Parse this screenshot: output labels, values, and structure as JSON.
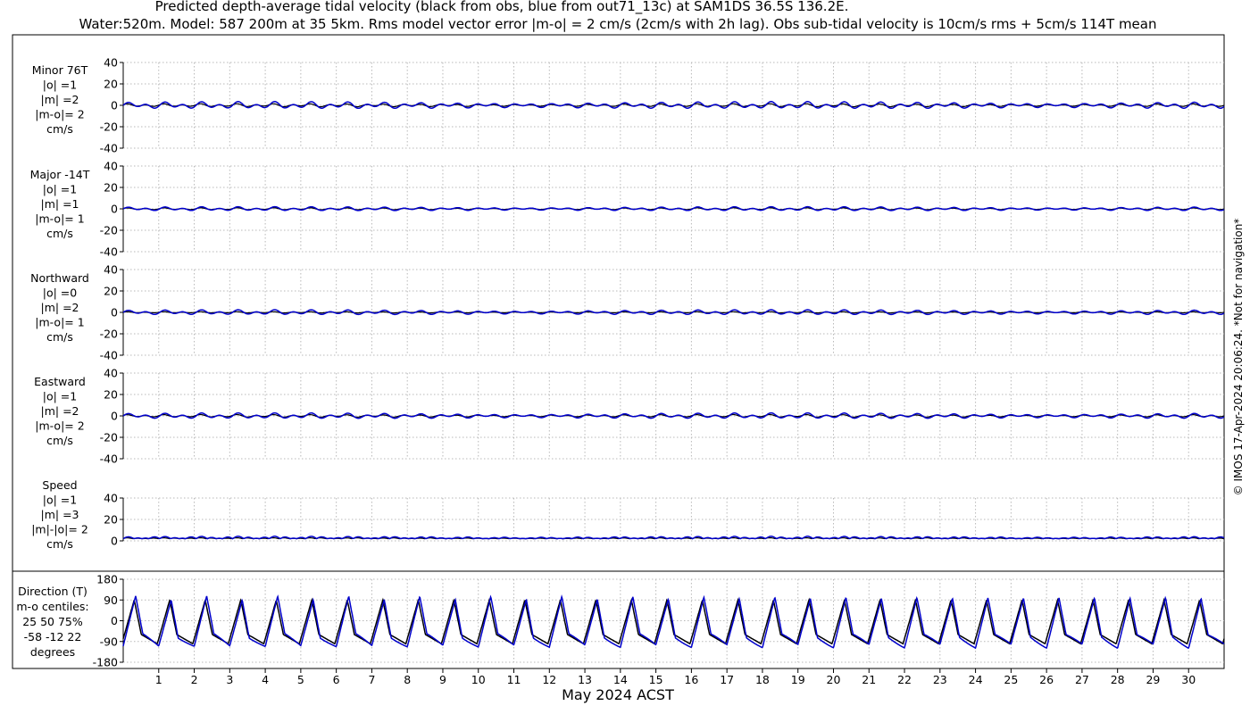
{
  "chart_data": {
    "type": "line",
    "title": "Predicted depth-average tidal velocity (black from obs, blue from out71_13c) at SAM1DS 36.5S 136.2E.",
    "subtitle": "Water:520m. Model: 587 200m at 35 5km. Rms model vector error |m-o| = 2 cm/s (2cm/s with 2h lag). Obs sub-tidal velocity is 10cm/s rms + 5cm/s 114T mean",
    "xlabel": "May 2024 ACST",
    "x_ticks": [
      "1",
      "2",
      "3",
      "4",
      "5",
      "6",
      "7",
      "8",
      "9",
      "10",
      "11",
      "12",
      "13",
      "14",
      "15",
      "16",
      "17",
      "18",
      "19",
      "20",
      "21",
      "22",
      "23",
      "24",
      "25",
      "26",
      "27",
      "28",
      "29",
      "30"
    ],
    "xlim": [
      0,
      31
    ],
    "grid": true,
    "copyright": "© IMOS 17-Apr-2024 20:06:24. *Not for navigation*",
    "colors": {
      "obs": "#000000",
      "model": "#0000cc",
      "grid": "#b8b8b8"
    },
    "panels": [
      {
        "id": "minor",
        "labels": [
          "Minor 76T",
          "|o| =1",
          "|m| =2",
          "|m-o|= 2",
          "cm/s"
        ],
        "ylim": [
          -40,
          40
        ],
        "yticks": [
          "40",
          "20",
          "0",
          "-20",
          "-40"
        ],
        "yvals": [
          40,
          20,
          0,
          -20,
          -40
        ],
        "obs_amp": 1.5,
        "model_amp": 3.5,
        "obs_phase": 0.3,
        "model_phase": 0.0,
        "offset": 0
      },
      {
        "id": "major",
        "labels": [
          "Major -14T",
          "|o| =1",
          "|m| =1",
          "|m-o|= 1",
          "cm/s"
        ],
        "ylim": [
          -40,
          40
        ],
        "yticks": [
          "40",
          "20",
          "0",
          "-20",
          "-40"
        ],
        "yvals": [
          40,
          20,
          0,
          -20,
          -40
        ],
        "obs_amp": 1.0,
        "model_amp": 2.0,
        "obs_phase": 0.2,
        "model_phase": 0.0,
        "offset": 0
      },
      {
        "id": "northward",
        "labels": [
          "Northward",
          "|o| =0",
          "|m| =2",
          "|m-o|= 1",
          "cm/s"
        ],
        "ylim": [
          -40,
          40
        ],
        "yticks": [
          "40",
          "20",
          "0",
          "-20",
          "-40"
        ],
        "yvals": [
          40,
          20,
          0,
          -20,
          -40
        ],
        "obs_amp": 0.6,
        "model_amp": 2.5,
        "obs_phase": 0.3,
        "model_phase": 0.0,
        "offset": 0
      },
      {
        "id": "eastward",
        "labels": [
          "Eastward",
          "|o| =1",
          "|m| =2",
          "|m-o|= 2",
          "cm/s"
        ],
        "ylim": [
          -40,
          40
        ],
        "yticks": [
          "40",
          "20",
          "0",
          "-20",
          "-40"
        ],
        "yvals": [
          40,
          20,
          0,
          -20,
          -40
        ],
        "obs_amp": 1.3,
        "model_amp": 2.8,
        "obs_phase": 0.3,
        "model_phase": 0.0,
        "offset": 0
      },
      {
        "id": "speed",
        "labels": [
          "Speed",
          "|o| =1",
          "|m| =3",
          "|m|-|o|= 2",
          "cm/s"
        ],
        "ylim": [
          0,
          40
        ],
        "yticks": [
          "40",
          "20",
          "0"
        ],
        "yvals": [
          40,
          20,
          0
        ],
        "obs_amp": 1.0,
        "model_amp": 2.5,
        "obs_phase": 0.3,
        "model_phase": 0.0,
        "offset": 2
      }
    ],
    "direction": {
      "labels": [
        "Direction (T)",
        "m-o centiles:",
        "25  50  75%",
        "-58  -12  22",
        "degrees"
      ],
      "ylim": [
        -180,
        180
      ],
      "yticks": [
        "180",
        "90",
        "0",
        "-90",
        "-180"
      ],
      "yvals": [
        180,
        90,
        0,
        -90,
        -180
      ]
    }
  }
}
